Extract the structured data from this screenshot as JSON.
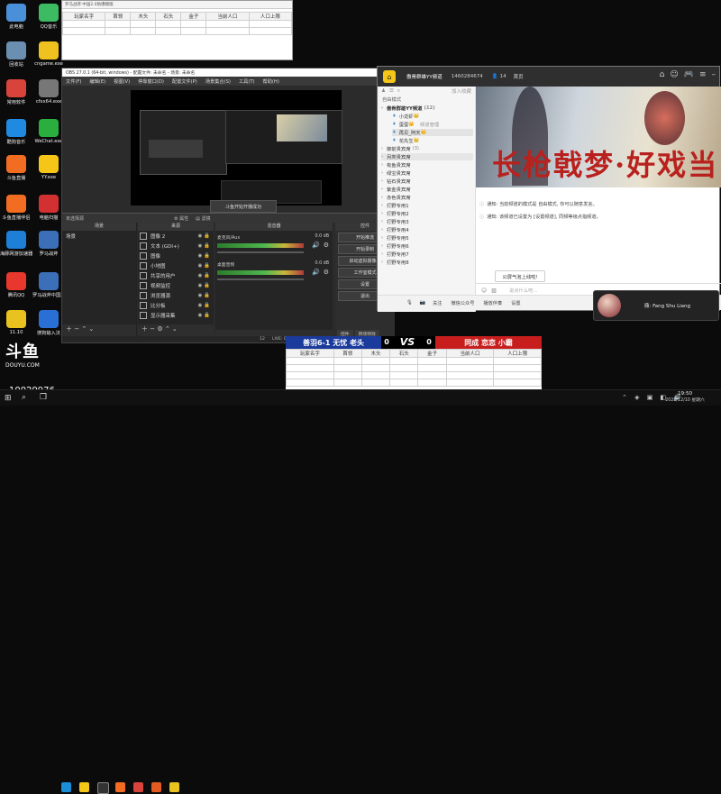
{
  "desktop": {
    "icons": [
      {
        "label": "此电脑",
        "color": "#4a90d9"
      },
      {
        "label": "回收站",
        "color": "#6a8fb0"
      },
      {
        "label": "常用软件",
        "color": "#d8433b"
      },
      {
        "label": "酷狗音乐",
        "color": "#1f8ae0"
      },
      {
        "label": "斗鱼直播",
        "color": "#f26d21"
      },
      {
        "label": "斗鱼直播伴侣",
        "color": "#f26d21"
      },
      {
        "label": "海豚网游加速器5.0",
        "color": "#1d7fd6"
      },
      {
        "label": "腾讯QQ",
        "color": "#e8382d"
      },
      {
        "label": "11.10",
        "color": "#e8c21f"
      },
      {
        "label": "QQ音乐",
        "color": "#3dbb62"
      },
      {
        "label": "cngame.exe",
        "color": "#f0c21f"
      },
      {
        "label": "cfxx64.exe",
        "color": "#777777"
      },
      {
        "label": "WeChat.exe",
        "color": "#2aae3e"
      },
      {
        "label": "YY.exe",
        "color": "#f5c518"
      },
      {
        "label": "电脑扫描",
        "color": "#d33131"
      },
      {
        "label": "罗马战斧",
        "color": "#3b6fb8"
      },
      {
        "label": "罗马战斧中国2.0防爆模版",
        "color": "#3b6fb8"
      },
      {
        "label": "搜狗输入法",
        "color": "#2a6fd6"
      }
    ]
  },
  "excel_top": {
    "title": "罗马战斧·中国2.0防爆模版",
    "headers": [
      "玩家名字",
      "首领",
      "木头",
      "石头",
      "金子",
      "当前人口",
      "人口上限"
    ]
  },
  "obs": {
    "title": "OBS 27.0.1 (64-bit, windows) - 配置文件: 未命名 - 场景: 未命名",
    "menu": [
      "文件(F)",
      "编辑(E)",
      "视图(V)",
      "停靠窗口(D)",
      "配置文件(P)",
      "场景集合(S)",
      "工具(T)",
      "帮助(H)"
    ],
    "toast": "斗鱼开始开播成功",
    "toolbar": {
      "properties": "属性",
      "filters": "滤镜",
      "source_label": "未选择源"
    },
    "scenes": {
      "header": "场景",
      "items": [
        "场景"
      ]
    },
    "sources": {
      "header": "来源",
      "items": [
        {
          "name": "图像 2",
          "tail": ""
        },
        {
          "name": "文本 (GDI+)",
          "tail": ""
        },
        {
          "name": "图像",
          "tail": ""
        },
        {
          "name": "小地图",
          "tail": ""
        },
        {
          "name": "共享的用户",
          "tail": ""
        },
        {
          "name": "视频监控",
          "tail": ""
        },
        {
          "name": "浏览器源",
          "tail": ""
        },
        {
          "name": "比分板",
          "tail": ""
        },
        {
          "name": "显示器采集",
          "tail": ""
        }
      ]
    },
    "mixer": {
      "header": "混音器",
      "channels": [
        {
          "name": "麦克风/Aux",
          "db": "0.0 dB"
        },
        {
          "name": "桌面音频",
          "db": "0.0 dB"
        }
      ]
    },
    "controls": {
      "header": "控件",
      "buttons": [
        "开始推流",
        "开始录制",
        "启动虚拟摄像机",
        "工作室模式",
        "设置",
        "退出"
      ]
    },
    "dock_tabs": [
      "控件",
      "转场特效"
    ],
    "status": {
      "live": "LIVE: 00:00:00",
      "rec": "REC: 00:00:00",
      "cpu": "CPU: 2.0%, 60.00 fps",
      "fps": "12"
    }
  },
  "yy": {
    "title": "傲骨群雄YY频道",
    "channel_id": "1460284674",
    "members": "14",
    "tab": "首页",
    "add_friend": "加入收藏",
    "sidebar_mode": "自由模式",
    "top_channel": {
      "name": "傲骨群雄YY频道",
      "count": "(12)"
    },
    "users": [
      {
        "name": "小龙虾",
        "tag": ""
      },
      {
        "name": "蛋蛋",
        "tag": "频道管理"
      },
      {
        "name": "再见_阿天",
        "tag": ""
      },
      {
        "name": "花先生",
        "tag": ""
      }
    ],
    "rooms": [
      {
        "name": "御前贵宾席",
        "count": "(3)"
      },
      {
        "name": "另类贵宾席",
        "count": ""
      },
      {
        "name": "有鱼贵宾席",
        "count": ""
      },
      {
        "name": "绿宝贵宾席",
        "count": ""
      },
      {
        "name": "钻石贵宾席",
        "count": ""
      },
      {
        "name": "紫金贵宾席",
        "count": ""
      },
      {
        "name": "赤色贵宾席",
        "count": ""
      },
      {
        "name": "打野专用1",
        "count": ""
      },
      {
        "name": "打野专用2",
        "count": ""
      },
      {
        "name": "打野专用3",
        "count": ""
      },
      {
        "name": "打野专用4",
        "count": ""
      },
      {
        "name": "打野专用5",
        "count": ""
      },
      {
        "name": "打野专用6",
        "count": ""
      },
      {
        "name": "打野专用7",
        "count": ""
      },
      {
        "name": "打野专用8",
        "count": ""
      }
    ],
    "banner_text": "长枪戟梦·好戏当",
    "notices": [
      "通知: 当前频道的模式是 自由模式, 你可以随意发言。",
      "通知: 该频道已设置为 [设置频道], 同频等级点指频道。"
    ],
    "announcement_btn": "公屏气泡上线啦!",
    "chat_placeholder": "说点什么吧...",
    "bottom": {
      "follow": "关注",
      "gift": "微信公众号",
      "live": "播放伴奏",
      "settings": "设置"
    }
  },
  "notif": {
    "text": "鼎: Fang Shu Liang"
  },
  "score_bar": {
    "left_team": "善羽6-1 无忧 老头",
    "left_score": "0",
    "vs": "VS",
    "right_score": "0",
    "right_team": "同成 恋恋 小霸",
    "headers": [
      "玩家名字",
      "首领",
      "木头",
      "石头",
      "金子",
      "当前人口",
      "人口上限"
    ]
  },
  "douyu": {
    "logo": "斗鱼",
    "sub": "DOUYU.COM",
    "room_id": "10029976"
  },
  "taskbar": {
    "time": "19:50",
    "date": "2022/12/10 星期六",
    "lang": "中"
  },
  "colors": {
    "yy_orange": "#f26d21",
    "obs_bg": "#2b2b2b",
    "vs_blue": "#1a3a9c",
    "vs_red": "#c81d1d"
  }
}
